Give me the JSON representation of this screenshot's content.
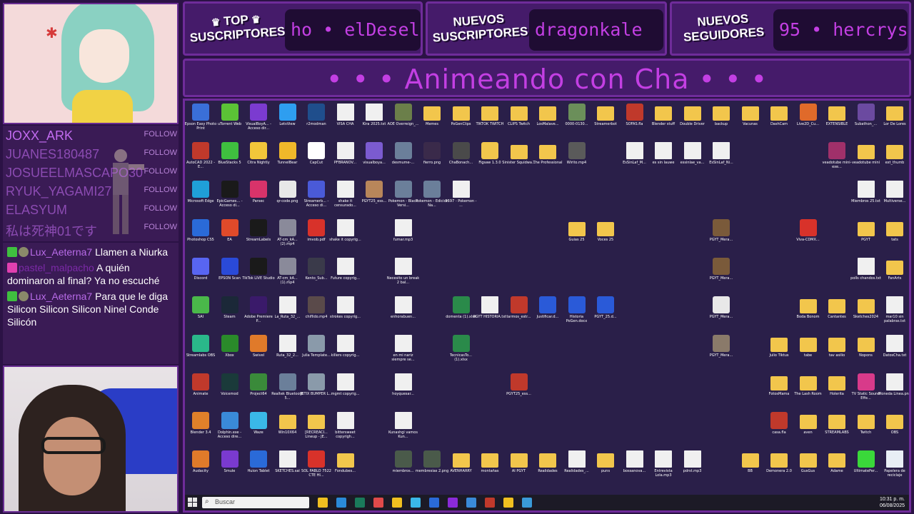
{
  "banners": {
    "top_subs": {
      "line1": "TOP",
      "line2": "SUSCRIPTORES",
      "ticker": "ho • elDesel"
    },
    "new_subs": {
      "line1": "NUEVOS",
      "line2": "SUSCRIPTORES",
      "ticker": "dragonkale"
    },
    "new_followers": {
      "line1": "NUEVOS",
      "line2": "SEGUIDORES",
      "ticker": "95 • hercrys"
    }
  },
  "stream_title": "• • • Animeando con Cha • • •",
  "recent_followers": [
    {
      "name": "JOXX_ARK",
      "action": "FOLLOW"
    },
    {
      "name": "JUANES180487",
      "action": "FOLLOW"
    },
    {
      "name": "JOSUEELMASCAPO30",
      "action": "FOLLOW"
    },
    {
      "name": "RYUK_YAGAMI27",
      "action": "FOLLOW"
    },
    {
      "name": "ELASYUM",
      "action": "FOLLOW"
    },
    {
      "name": "私は死神01です",
      "action": "FOLLOW"
    }
  ],
  "chat": [
    {
      "user": "Lux_Aeterna7",
      "text": "Llamen a Niurka",
      "badge_color": "#3fbf3f",
      "dim": false
    },
    {
      "user": "pastel_malpacho",
      "text": "A quién dominaron al final? Ya no escuché",
      "badge_color": "#e040b0",
      "dim": true
    },
    {
      "user": "Lux_Aeterna7",
      "text": "Para que le diga Silicon Silicon Silicon Ninel Conde Silicón",
      "badge_color": "#3fbf3f",
      "dim": false
    }
  ],
  "desktop_icons": [
    {
      "label": "Epson Easy Photo Print",
      "kind": "app",
      "color": "#3a6fd8"
    },
    {
      "label": "uTorrent Web",
      "kind": "app",
      "color": "#5bc236"
    },
    {
      "label": "VisualBoyA... - Acceso dir...",
      "kind": "app",
      "color": "#7b3bd0"
    },
    {
      "label": "LetsView",
      "kind": "app",
      "color": "#2e9ef0"
    },
    {
      "label": "r2modman",
      "kind": "app",
      "color": "#1f4e8c"
    },
    {
      "label": "VISA CHA",
      "kind": "doc",
      "color": "#f0f0f0"
    },
    {
      "label": "Kira 2025.txt",
      "kind": "doc",
      "color": "#f0f0f0"
    },
    {
      "label": "AOE Overreign_...",
      "kind": "app",
      "color": "#6b7f4a"
    },
    {
      "label": "Memes",
      "kind": "folder",
      "color": "#f2c64c"
    },
    {
      "label": "PoGenClips",
      "kind": "folder",
      "color": "#f2c64c"
    },
    {
      "label": "TIKTOK TWITCH",
      "kind": "folder",
      "color": "#f2c64c"
    },
    {
      "label": "CLIPS Twitch",
      "kind": "folder",
      "color": "#f2c64c"
    },
    {
      "label": "LosMalave...",
      "kind": "folder",
      "color": "#f2c64c"
    },
    {
      "label": "0000-0130...",
      "kind": "app",
      "color": "#6b8f5a"
    },
    {
      "label": "Streamerbot",
      "kind": "folder",
      "color": "#f2c64c"
    },
    {
      "label": "SOFAS.fla",
      "kind": "app",
      "color": "#c0392b"
    },
    {
      "label": "Blender stuff",
      "kind": "folder",
      "color": "#f2c64c"
    },
    {
      "label": "Double Driver",
      "kind": "folder",
      "color": "#f2c64c"
    },
    {
      "label": "backup",
      "kind": "folder",
      "color": "#f2c64c"
    },
    {
      "label": "Vacunas",
      "kind": "folder",
      "color": "#f2c64c"
    },
    {
      "label": "DashCam",
      "kind": "folder",
      "color": "#f2c64c"
    },
    {
      "label": "Live2D_Cu...",
      "kind": "app",
      "color": "#e06a2a"
    },
    {
      "label": "EXTENSIBLE",
      "kind": "folder",
      "color": "#f2c64c"
    },
    {
      "label": "Subathon_...",
      "kind": "app",
      "color": "#6b4aa0"
    },
    {
      "label": "Lor De Lores",
      "kind": "folder",
      "color": "#f2c64c"
    },
    {
      "label": "AutoCAD 2022 - E...",
      "kind": "app",
      "color": "#c0392b"
    },
    {
      "label": "BlueStacks 5",
      "kind": "app",
      "color": "#3fbf3f"
    },
    {
      "label": "Citra Nightly",
      "kind": "app",
      "color": "#f2c63a"
    },
    {
      "label": "TunnelBear",
      "kind": "app",
      "color": "#f0b82a"
    },
    {
      "label": "CapCut",
      "kind": "app",
      "color": "#ffffff"
    },
    {
      "label": "PFBRANOV...",
      "kind": "doc",
      "color": "#f0f0f0"
    },
    {
      "label": "visualboya...",
      "kind": "app",
      "color": "#7b5bd0"
    },
    {
      "label": "desmume-...",
      "kind": "app",
      "color": "#6b7f9a"
    },
    {
      "label": "fierro.png",
      "kind": "app",
      "color": "#3a2a4a"
    },
    {
      "label": "ChaBonach...",
      "kind": "app",
      "color": "#4a4a4a"
    },
    {
      "label": "Figsaw 1.3.0",
      "kind": "app",
      "color": "#f2c64c"
    },
    {
      "label": "Sinister Squidwa...",
      "kind": "folder",
      "color": "#f2c64c"
    },
    {
      "label": "The Professional",
      "kind": "folder",
      "color": "#f2c64c"
    },
    {
      "label": "Wirito.mp4",
      "kind": "app",
      "color": "#5a5a5a"
    },
    {
      "label": "EsSinLaf_M...",
      "kind": "doc",
      "color": "#f0f0f0"
    },
    {
      "label": "es sin lauwe",
      "kind": "doc",
      "color": "#f0f0f0"
    },
    {
      "label": "essinlae_va...",
      "kind": "doc",
      "color": "#f0f0f0"
    },
    {
      "label": "EsSinLaf_Ni...",
      "kind": "doc",
      "color": "#f0f0f0"
    },
    {
      "label": "veadotube mini-exe...",
      "kind": "app",
      "color": "#a0306a"
    },
    {
      "label": "veadotube mini",
      "kind": "folder",
      "color": "#f2c64c"
    },
    {
      "label": "ext_thumb",
      "kind": "folder",
      "color": "#f2c64c"
    },
    {
      "label": "Microsoft Edge",
      "kind": "app",
      "color": "#1f9fd8"
    },
    {
      "label": "EpicGames... - Acceso di...",
      "kind": "app",
      "color": "#1a1a1a"
    },
    {
      "label": "Parsec",
      "kind": "app",
      "color": "#d8336a"
    },
    {
      "label": "qr-code.png",
      "kind": "app",
      "color": "#e8e8e8"
    },
    {
      "label": "Streamerb... - Acceso di...",
      "kind": "app",
      "color": "#4a5ad8"
    },
    {
      "label": "shake it censurado...",
      "kind": "doc",
      "color": "#f0f0f0"
    },
    {
      "label": "PGYT25_ess...",
      "kind": "app",
      "color": "#b8865a"
    },
    {
      "label": "Pokemon - Black Versi...",
      "kind": "app",
      "color": "#6b7f9a"
    },
    {
      "label": "Pokemon - Edicion Na...",
      "kind": "app",
      "color": "#6b7f9a"
    },
    {
      "label": "5597 - Pokemon - ...",
      "kind": "doc",
      "color": "#f0f0f0"
    },
    {
      "label": "Miembros 25.txt",
      "kind": "doc",
      "color": "#f0f0f0"
    },
    {
      "label": "Multiverse...",
      "kind": "doc",
      "color": "#f0f0f0"
    },
    {
      "label": "Photoshop CS5",
      "kind": "app",
      "color": "#2a6ad8"
    },
    {
      "label": "EA",
      "kind": "app",
      "color": "#e04a2a"
    },
    {
      "label": "StreamLabels",
      "kind": "app",
      "color": "#1a1a1a"
    },
    {
      "label": "AT-cm_kA... (2).mp4",
      "kind": "app",
      "color": "#8a8a9a"
    },
    {
      "label": "imvob.pdf",
      "kind": "app",
      "color": "#d8322a"
    },
    {
      "label": "shake it copyrig...",
      "kind": "doc",
      "color": "#f0f0f0"
    },
    {
      "label": "fumar.mp3",
      "kind": "doc",
      "color": "#f0f0f0"
    },
    {
      "label": "Guias 25",
      "kind": "folder",
      "color": "#f2c64c"
    },
    {
      "label": "Voces 25",
      "kind": "folder",
      "color": "#f2c64c"
    },
    {
      "label": "PGYT_Mera...",
      "kind": "app",
      "color": "#7a5a3a"
    },
    {
      "label": "Viva-CDMX...",
      "kind": "app",
      "color": "#d8322a"
    },
    {
      "label": "PGYT",
      "kind": "folder",
      "color": "#f2c64c"
    },
    {
      "label": "tats",
      "kind": "folder",
      "color": "#f2c64c"
    },
    {
      "label": "Discord",
      "kind": "app",
      "color": "#5865f2"
    },
    {
      "label": "EPSON Scan",
      "kind": "app",
      "color": "#2a4ad8"
    },
    {
      "label": "TikTok LIVE Studio",
      "kind": "app",
      "color": "#1a1a1a"
    },
    {
      "label": "AT-cm_kA... (1).mp4",
      "kind": "app",
      "color": "#8a8a9a"
    },
    {
      "label": "Kento_Sub...",
      "kind": "app",
      "color": "#3a3a4a"
    },
    {
      "label": "Future copyrig...",
      "kind": "doc",
      "color": "#f0f0f0"
    },
    {
      "label": "Necesito un break 2 bal...",
      "kind": "doc",
      "color": "#f0f0f0"
    },
    {
      "label": "PGYT_Mera...",
      "kind": "app",
      "color": "#7a5a3a"
    },
    {
      "label": "polls chandos.txt",
      "kind": "doc",
      "color": "#f0f0f0"
    },
    {
      "label": "FanArts",
      "kind": "folder",
      "color": "#f2c64c"
    },
    {
      "label": "SAI",
      "kind": "app",
      "color": "#4ab84a"
    },
    {
      "label": "Steam",
      "kind": "app",
      "color": "#1b2838"
    },
    {
      "label": "Adobe Premiere P...",
      "kind": "app",
      "color": "#3a1a6a"
    },
    {
      "label": "La_Ruta_32_...",
      "kind": "doc",
      "color": "#f0f0f0"
    },
    {
      "label": "chiflido.mp4",
      "kind": "app",
      "color": "#5a4a4a"
    },
    {
      "label": "strokes copyrig...",
      "kind": "doc",
      "color": "#f0f0f0"
    },
    {
      "label": "enhorabuen...",
      "kind": "doc",
      "color": "#f0f0f0"
    },
    {
      "label": "domenta (1).xlsx",
      "kind": "app",
      "color": "#2a8a4a"
    },
    {
      "label": "PGYT HISTORIA.txt",
      "kind": "doc",
      "color": "#f0f0f0"
    },
    {
      "label": "tarmos_estr...",
      "kind": "app",
      "color": "#c0392b"
    },
    {
      "label": "Justificar.d...",
      "kind": "app",
      "color": "#2a5ad8"
    },
    {
      "label": "Historia PoGen.docx",
      "kind": "app",
      "color": "#2a5ad8"
    },
    {
      "label": "PGYT_25.d...",
      "kind": "app",
      "color": "#2a5ad8"
    },
    {
      "label": "PGYT_Mera...",
      "kind": "app",
      "color": "#e8e8e8"
    },
    {
      "label": "Boda Bonom",
      "kind": "folder",
      "color": "#f2c64c"
    },
    {
      "label": "Cantantes",
      "kind": "folder",
      "color": "#f2c64c"
    },
    {
      "label": "Sketches2024",
      "kind": "folder",
      "color": "#f2c64c"
    },
    {
      "label": "mar10 sin palabras.txt",
      "kind": "doc",
      "color": "#f0f0f0"
    },
    {
      "label": "Streamlabs OBS",
      "kind": "app",
      "color": "#2ab88a"
    },
    {
      "label": "Xbox",
      "kind": "app",
      "color": "#2a8a2a"
    },
    {
      "label": "Swivel",
      "kind": "app",
      "color": "#e07a2a"
    },
    {
      "label": "Ruta_32_2...",
      "kind": "doc",
      "color": "#f0f0f0"
    },
    {
      "label": "Julia Template...",
      "kind": "app",
      "color": "#8a9aaa"
    },
    {
      "label": "killers copyrig...",
      "kind": "doc",
      "color": "#f0f0f0"
    },
    {
      "label": "en mi nariz siempre se...",
      "kind": "doc",
      "color": "#f0f0f0"
    },
    {
      "label": "TecnicasTo... (1).xlsx",
      "kind": "app",
      "color": "#2a8a4a"
    },
    {
      "label": "PGYT_Mera...",
      "kind": "app",
      "color": "#8a7a6a"
    },
    {
      "label": "Julio Tiktus",
      "kind": "folder",
      "color": "#f2c64c"
    },
    {
      "label": "tabe",
      "kind": "folder",
      "color": "#f2c64c"
    },
    {
      "label": "tav asilio",
      "kind": "folder",
      "color": "#f2c64c"
    },
    {
      "label": "Nopons",
      "kind": "folder",
      "color": "#f2c64c"
    },
    {
      "label": "DatosCha.txt",
      "kind": "doc",
      "color": "#f0f0f0"
    },
    {
      "label": "Animate",
      "kind": "app",
      "color": "#c0392b"
    },
    {
      "label": "Voicemod",
      "kind": "app",
      "color": "#1a3a3a"
    },
    {
      "label": "Project64",
      "kind": "app",
      "color": "#3a8a3a"
    },
    {
      "label": "Realtek Bluetooth 5...",
      "kind": "app",
      "color": "#6b7f9a"
    },
    {
      "label": "JETIX BUMPER L...",
      "kind": "app",
      "color": "#8a9aaa"
    },
    {
      "label": "mgmt copyrig...",
      "kind": "doc",
      "color": "#f0f0f0"
    },
    {
      "label": "hoyquesar...",
      "kind": "doc",
      "color": "#f0f0f0"
    },
    {
      "label": "PGYT25_ess...",
      "kind": "app",
      "color": "#c0392b"
    },
    {
      "label": "FotosMama",
      "kind": "folder",
      "color": "#f2c64c"
    },
    {
      "label": "The Lash Room",
      "kind": "folder",
      "color": "#f2c64c"
    },
    {
      "label": "Holerita",
      "kind": "folder",
      "color": "#f2c64c"
    },
    {
      "label": "TV Static Sound Effe...",
      "kind": "app",
      "color": "#d83a8a"
    },
    {
      "label": "Moneda Linea.png",
      "kind": "doc",
      "color": "#f0f0f0"
    },
    {
      "label": "Blender 3.4",
      "kind": "app",
      "color": "#e0802a"
    },
    {
      "label": "Dolphin.exe - Acceso dire...",
      "kind": "app",
      "color": "#3a8ad8"
    },
    {
      "label": "Waze",
      "kind": "app",
      "color": "#3ab8e8"
    },
    {
      "label": "Win10X64",
      "kind": "folder",
      "color": "#f2c64c"
    },
    {
      "label": "[RECREACI... Lineup - JE...",
      "kind": "folder",
      "color": "#f2c64c"
    },
    {
      "label": "bittersweet copyrigh...",
      "kind": "doc",
      "color": "#f0f0f0"
    },
    {
      "label": "Kunashgi vamos Kun...",
      "kind": "doc",
      "color": "#f0f0f0"
    },
    {
      "label": "casa.fla",
      "kind": "app",
      "color": "#c0392b"
    },
    {
      "label": "aven",
      "kind": "folder",
      "color": "#f2c64c"
    },
    {
      "label": "STREAMLABS",
      "kind": "folder",
      "color": "#f2c64c"
    },
    {
      "label": "Twitch",
      "kind": "folder",
      "color": "#f2c64c"
    },
    {
      "label": "OBS",
      "kind": "folder",
      "color": "#f2c64c"
    },
    {
      "label": "Audacity",
      "kind": "app",
      "color": "#e07a2a"
    },
    {
      "label": "Smule",
      "kind": "app",
      "color": "#7a3ad0"
    },
    {
      "label": "Huion Tablet",
      "kind": "app",
      "color": "#2a6ad8"
    },
    {
      "label": "SKETCHES.sai",
      "kind": "doc",
      "color": "#f0f0f0"
    },
    {
      "label": "SOL PABLO 7522 CTE HI...",
      "kind": "app",
      "color": "#d8322a"
    },
    {
      "label": "Fondubes...",
      "kind": "folder",
      "color": "#f2c64c"
    },
    {
      "label": "miembros...",
      "kind": "app",
      "color": "#4a5a4a"
    },
    {
      "label": "membresias 2.png",
      "kind": "app",
      "color": "#4a5a4a"
    },
    {
      "label": "AVENHARRY",
      "kind": "folder",
      "color": "#f2c64c"
    },
    {
      "label": "montañas",
      "kind": "folder",
      "color": "#f2c64c"
    },
    {
      "label": "AI PGYT",
      "kind": "folder",
      "color": "#f2c64c"
    },
    {
      "label": "Realidades",
      "kind": "folder",
      "color": "#f2c64c"
    },
    {
      "label": "Realidades_...",
      "kind": "doc",
      "color": "#f0f0f0"
    },
    {
      "label": "puns",
      "kind": "folder",
      "color": "#f2c64c"
    },
    {
      "label": "bossanova...",
      "kind": "doc",
      "color": "#f0f0f0"
    },
    {
      "label": "Entrevista Lola.mp3",
      "kind": "doc",
      "color": "#f0f0f0"
    },
    {
      "label": "pdrst.mp3",
      "kind": "doc",
      "color": "#f0f0f0"
    },
    {
      "label": "BB",
      "kind": "folder",
      "color": "#f2c64c"
    },
    {
      "label": "Demonera 2.0",
      "kind": "folder",
      "color": "#f2c64c"
    },
    {
      "label": "GusGus",
      "kind": "folder",
      "color": "#f2c64c"
    },
    {
      "label": "Adame",
      "kind": "folder",
      "color": "#f2c64c"
    },
    {
      "label": "UltimatePer...",
      "kind": "app",
      "color": "#3ad83a"
    },
    {
      "label": "Papelera de reciclaje",
      "kind": "doc",
      "color": "#e8eef5"
    }
  ],
  "taskbar": {
    "search_placeholder": "Buscar",
    "time": "10:31 p. m.",
    "date": "06/08/2025",
    "apps": [
      "#f0c020",
      "#2a8ad8",
      "#1a7a5a",
      "#e04a4a",
      "#f0c020",
      "#3ab8e8",
      "#2a6ad8",
      "#8a2ad8",
      "#3a8ad8",
      "#c0392b",
      "#f0c020",
      "#3a9ad8"
    ]
  }
}
